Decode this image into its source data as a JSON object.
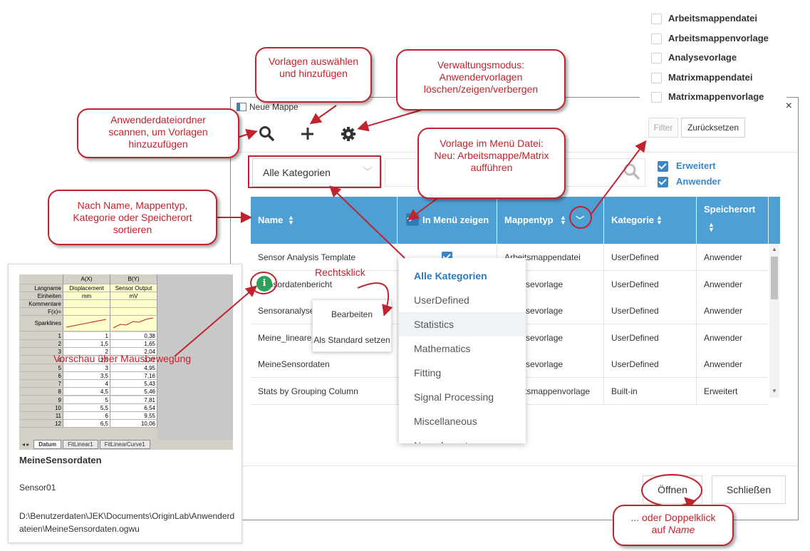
{
  "dialog": {
    "title": "Neue Mappe",
    "close_glyph": "×",
    "toolbar": {
      "search_icon": "search-icon",
      "add_icon": "plus-icon",
      "settings_icon": "gear-icon"
    },
    "filter_label": "Filter",
    "reset_label": "Zurücksetzen",
    "category_select": {
      "value": "Alle Kategorien",
      "chevron": "﹀"
    },
    "search_placeholder": "",
    "checkboxes": [
      {
        "label": "Erweitert",
        "checked": true
      },
      {
        "label": "Anwender",
        "checked": true
      }
    ],
    "table": {
      "headers": [
        "Name",
        "In Menü zeigen",
        "Mappentyp",
        "Kategorie",
        "Speicherort"
      ],
      "rows": [
        {
          "name": "Sensor Analysis Template",
          "type": "Arbeitsmappendatei",
          "category": "UserDefined",
          "location": "Anwender"
        },
        {
          "name": "Sensordatenbericht",
          "type": "Analysevorlage",
          "category": "UserDefined",
          "location": "Anwender"
        },
        {
          "name": "Sensoranalyse",
          "type": "Analysevorlage",
          "category": "UserDefined",
          "location": "Anwender"
        },
        {
          "name": "Meine_lineare_Anpassung",
          "type": "Analysevorlage",
          "category": "UserDefined",
          "location": "Anwender"
        },
        {
          "name": "MeineSensordaten",
          "type": "Analysevorlage",
          "category": "UserDefined",
          "location": "Anwender"
        },
        {
          "name": "Stats by Grouping Column",
          "type": "Arbeitsmappenvorlage",
          "category": "Built-in",
          "location": "Erweitert"
        }
      ]
    },
    "open_label": "Öffnen",
    "close_label": "Schließen"
  },
  "filter_panel": {
    "items": [
      "Arbeitsmappendatei",
      "Arbeitsmappenvorlage",
      "Analysevorlage",
      "Matrixmappendatei",
      "Matrixmappenvorlage"
    ]
  },
  "dropdown": {
    "items": [
      "Alle Kategorien",
      "UserDefined",
      "Statistics",
      "Mathematics",
      "Fitting",
      "Signal Processing",
      "Miscellaneous",
      "Nonrelevant"
    ],
    "selected": "Alle Kategorien",
    "hovered": "Statistics"
  },
  "context_menu": {
    "items": [
      "Bearbeiten",
      "Als Standard setzen"
    ]
  },
  "preview": {
    "title": "MeineSensordaten",
    "subtitle": "Sensor01",
    "path": "D:\\Benutzerdaten\\JEK\\Documents\\OriginLab\\Anwenderdateien\\MeineSensordaten.ogwu",
    "info_icon": "info-icon",
    "sheet": {
      "col_headers": [
        "A(X)",
        "B(Y)"
      ],
      "row_labels": [
        "Langname",
        "Einheiten",
        "Kommentare",
        "F(x)=",
        "Sparklines"
      ],
      "longnames": [
        "Displacement",
        "Sensor Output"
      ],
      "units": [
        "mm",
        "mV"
      ],
      "rows": [
        [
          "1",
          "1",
          "0,38"
        ],
        [
          "2",
          "1,5",
          "1,65"
        ],
        [
          "3",
          "2",
          "2,04"
        ],
        [
          "4",
          "2,5",
          "3,77"
        ],
        [
          "5",
          "3",
          "4,95"
        ],
        [
          "6",
          "3,5",
          "7,16"
        ],
        [
          "7",
          "4",
          "5,43"
        ],
        [
          "8",
          "4,5",
          "5,46"
        ],
        [
          "9",
          "5",
          "7,81"
        ],
        [
          "10",
          "5,5",
          "6,54"
        ],
        [
          "11",
          "6",
          "9,55"
        ],
        [
          "12",
          "6,5",
          "10,06"
        ]
      ],
      "tabs": [
        "Datum",
        "FitLinear1",
        "FitLinearCurve1"
      ]
    }
  },
  "callouts": {
    "scan": "Anwenderdateiordner scannen, um Vorlagen hinzuzufügen",
    "add": "Vorlagen auswählen und hinzufügen",
    "admin": "Verwaltungsmodus: Anwendervorlagen löschen/zeigen/verbergen",
    "menu": "Vorlage im Menü Datei: Neu: Arbeitsmappe/Matrix aufführen",
    "sort": "Nach Name, Mappentyp, Kategorie oder Speicherort sortieren",
    "rightclick": "Rechtsklick",
    "preview": "Vorschau über Mausbewegung",
    "doubleclick_1": "... oder Doppelklick",
    "doubleclick_2": "auf",
    "doubleclick_3": "Name"
  },
  "colors": {
    "header_blue": "#4e9fd3",
    "accent": "#3a86c8",
    "callout_red": "#c0232d"
  }
}
